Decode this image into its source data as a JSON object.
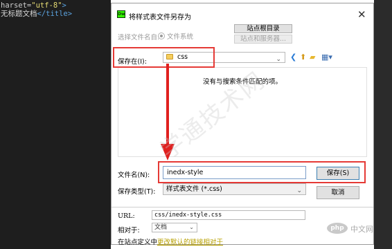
{
  "editor": {
    "line1_attr": "harset=",
    "line1_value": "\"utf-8\"",
    "line1_close": ">",
    "line2_text": "无标题文档",
    "line2_tag": "</title>"
  },
  "dialog": {
    "app_icon_text": "Dw",
    "title": "将样式表文件另存为",
    "close_glyph": "✕",
    "select_file_name_label": "选择文件名自:",
    "file_system_option": "文件系统",
    "site_root_button": "站点根目录",
    "site_server_button": "站点和服务器...",
    "save_in_label": "保存在(I):",
    "save_in_value": "css",
    "empty_message": "没有与搜索条件匹配的项。",
    "filename_label": "文件名(N):",
    "filename_value": "inedx-style",
    "save_button": "保存(S)",
    "save_type_label": "保存类型(T):",
    "save_type_value": "样式表文件 (*.css)",
    "cancel_button": "取消",
    "url_label": "URL:",
    "url_value": "css/inedx-style.css",
    "relative_label": "相对于:",
    "relative_value": "文档",
    "define_prefix": "在站点定义中",
    "define_link": "更改默认的链接相对于"
  },
  "watermark_text": "学通技术网",
  "brand": {
    "logo_text": "php",
    "site_text": "中文网"
  },
  "colors": {
    "annotation_red": "#e53935",
    "editor_bg": "#1e1e1e",
    "dreamweaver_green": "#35fa00"
  }
}
